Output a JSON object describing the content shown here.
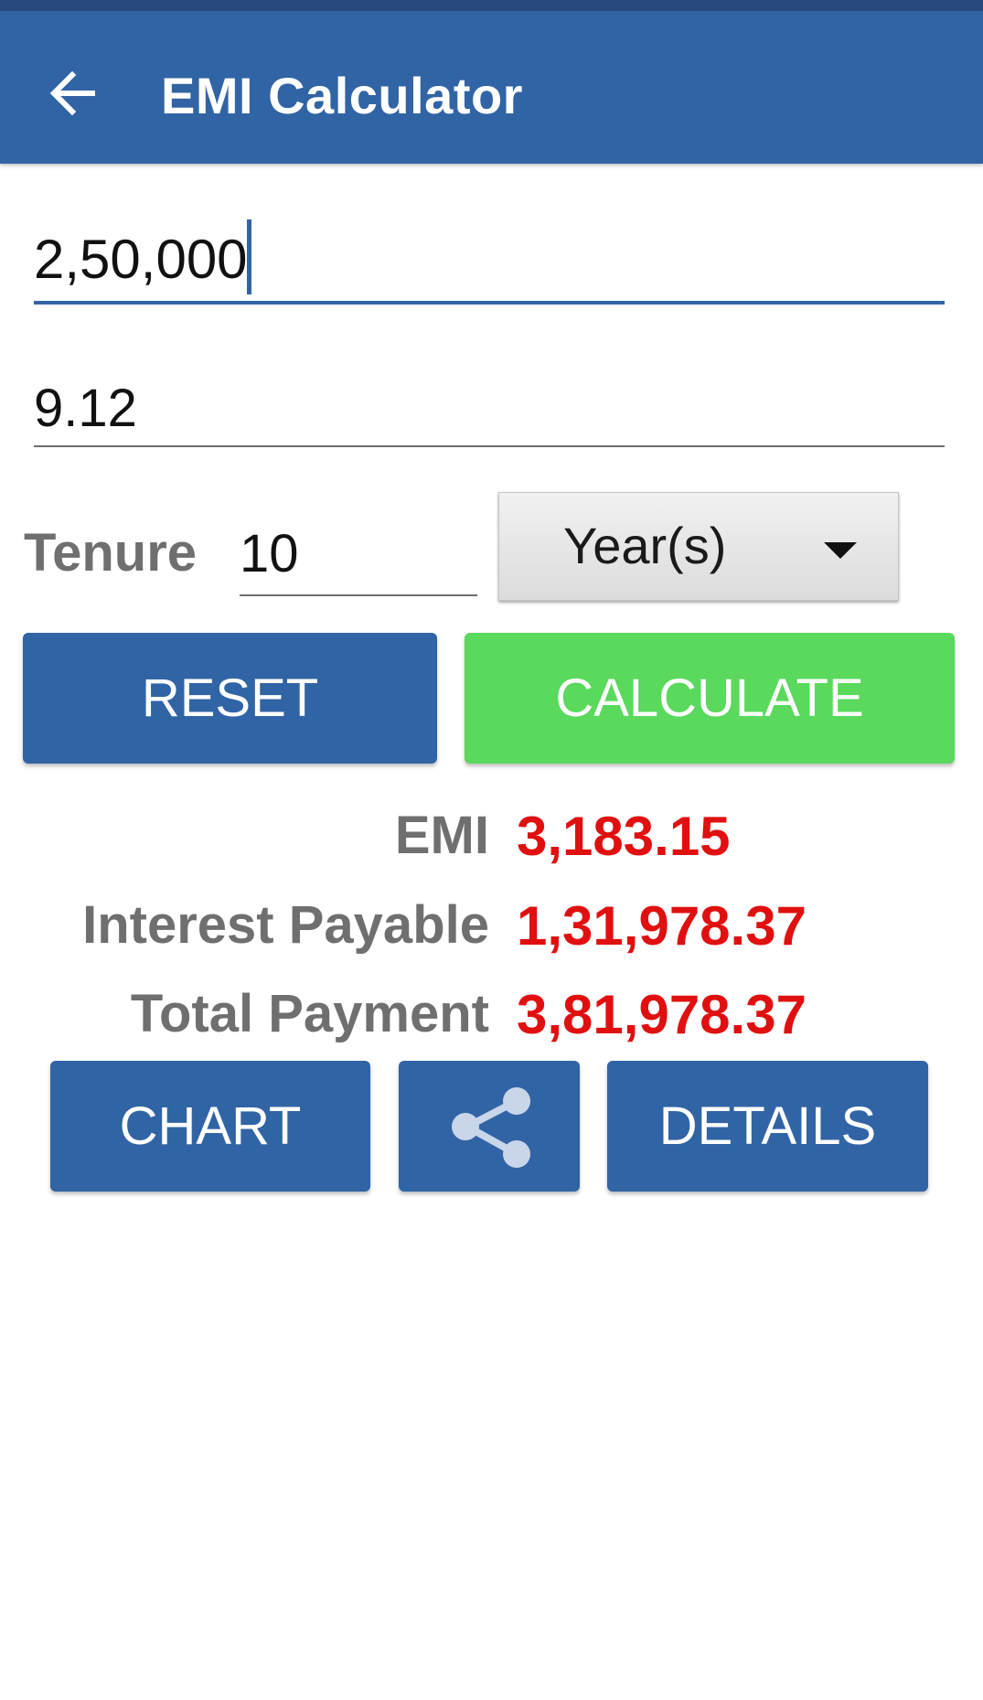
{
  "app_bar": {
    "title": "EMI Calculator",
    "back_icon": "arrow-left-icon"
  },
  "form": {
    "amount_value": "2,50,000",
    "rate_value": "9.12",
    "tenure_label": "Tenure",
    "tenure_value": "10",
    "tenure_unit_selected": "Year(s)"
  },
  "actions": {
    "reset_label": "RESET",
    "calculate_label": "CALCULATE"
  },
  "results": {
    "emi_label": "EMI",
    "emi_value": "3,183.15",
    "interest_label": "Interest Payable",
    "interest_value": "1,31,978.37",
    "total_label": "Total Payment",
    "total_value": "3,81,978.37"
  },
  "bottom_actions": {
    "chart_label": "CHART",
    "share_icon": "share-icon",
    "details_label": "DETAILS"
  },
  "colors": {
    "primary": "#3164a5",
    "accent_green": "#5ad95c",
    "result_red": "#e01010",
    "label_gray": "#6f6f6f"
  }
}
